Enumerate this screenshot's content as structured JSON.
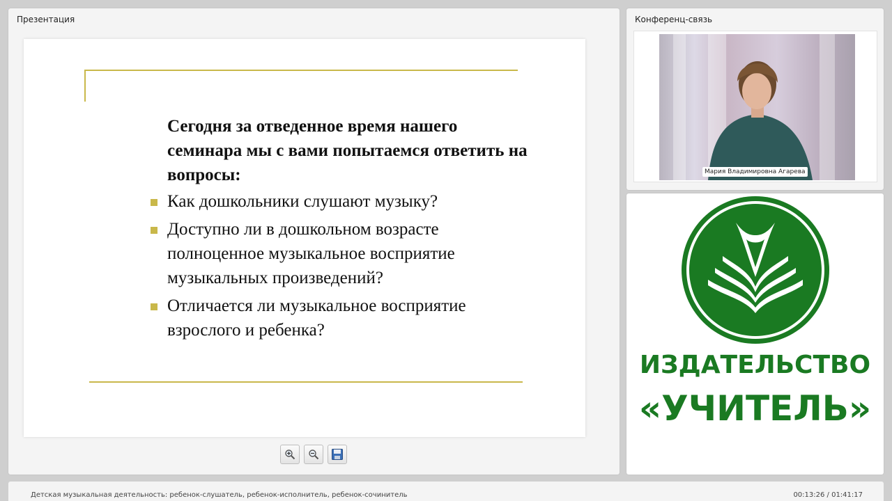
{
  "presentation": {
    "panel_title": "Презентация",
    "slide": {
      "heading": "Сегодня за отведенное время нашего семинара мы с вами попытаемся ответить на вопросы:",
      "bullets": [
        "Как дошкольники слушают музыку?",
        "Доступно ли в дошкольном возрасте полноценное музыкальное восприятие музыкальных произведений?",
        "Отличается ли музыкальное восприятие взрослого и ребенка?"
      ],
      "accent_color": "#c9b84a"
    },
    "toolbar": {
      "zoom_in_icon": "zoom-in-icon",
      "zoom_out_icon": "zoom-out-icon",
      "save_icon": "save-icon"
    }
  },
  "conference": {
    "panel_title": "Конференц-связь",
    "speaker_name": "Мария Владимировна Агарева"
  },
  "publisher": {
    "line1": "ИЗДАТЕЛЬСТВО",
    "line2": "«УЧИТЕЛЬ»",
    "brand_color": "#1a7a22"
  },
  "footer": {
    "title": "Детская музыкальная деятельность: ребенок-слушатель, ребенок-исполнитель, ребенок-сочинитель",
    "time": "00:13:26 / 01:41:17"
  }
}
